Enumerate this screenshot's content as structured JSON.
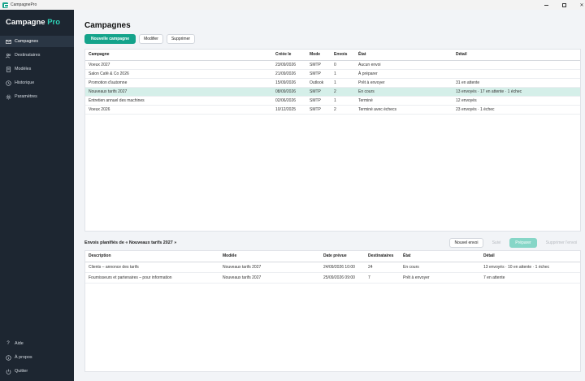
{
  "window": {
    "title": "CampagnePro"
  },
  "brand": {
    "name": "Campagne",
    "accent": "Pro"
  },
  "sidebar": {
    "items": [
      {
        "label": "Campagnes",
        "icon": "mail-icon",
        "active": true
      },
      {
        "label": "Destinataires",
        "icon": "users-icon"
      },
      {
        "label": "Modèles",
        "icon": "document-icon"
      },
      {
        "label": "Historique",
        "icon": "clock-icon"
      },
      {
        "label": "Paramètres",
        "icon": "gear-icon"
      }
    ],
    "bottom": [
      {
        "label": "Aide",
        "icon": "help-icon"
      },
      {
        "label": "À propos",
        "icon": "info-icon"
      },
      {
        "label": "Quitter",
        "icon": "power-icon"
      }
    ]
  },
  "page": {
    "title": "Campagnes"
  },
  "toolbar": {
    "new_campaign": "Nouvelle campagne",
    "edit": "Modifier",
    "delete": "Supprimer"
  },
  "campaigns": {
    "headers": [
      "Campagne",
      "Créée le",
      "Mode",
      "Envois",
      "État",
      "Détail"
    ],
    "rows": [
      [
        "Voeux 2027",
        "23/09/2026",
        "SMTP",
        "0",
        "Aucun envoi",
        ""
      ],
      [
        "Salon Café & Co 2026",
        "21/09/2026",
        "SMTP",
        "1",
        "À préparer",
        ""
      ],
      [
        "Promotion d'automne",
        "15/09/2026",
        "Outlook",
        "1",
        "Prêt à envoyer",
        "31 en attente"
      ],
      [
        "Nouveaux tarifs 2027",
        "08/09/2026",
        "SMTP",
        "2",
        "En cours",
        "13 envoyés · 17 en attente · 1 échec"
      ],
      [
        "Entretien annuel des machines",
        "02/06/2026",
        "SMTP",
        "1",
        "Terminé",
        "12 envoyés"
      ],
      [
        "Voeux 2026",
        "10/12/2025",
        "SMTP",
        "2",
        "Terminé avec échecs",
        "23 envoyés · 1 échec"
      ]
    ],
    "selected_index": 3
  },
  "sends": {
    "title": "Envois planifiés de « Nouveaux tarifs 2027 »",
    "toolbar": {
      "new_send": "Nouvel envoi",
      "follow": "Suivi",
      "prepare": "Préparer",
      "delete": "Supprimer l'envoi"
    },
    "headers": [
      "Description",
      "Modèle",
      "Date prévue",
      "Destinataires",
      "État",
      "Détail"
    ],
    "rows": [
      [
        "Clients – annonce des tarifs",
        "Nouveaux tarifs 2027",
        "24/09/2026 10:00",
        "24",
        "En cours",
        "13 envoyés · 10 en attente · 1 échec"
      ],
      [
        "Fournisseurs et partenaires – pour information",
        "Nouveaux tarifs 2027",
        "25/09/2026 09:00",
        "7",
        "Prêt à envoyer",
        "7 en attente"
      ]
    ]
  },
  "colors": {
    "accent": "#14a38b",
    "sidebar_bg": "#1d2631",
    "selected_row": "#d5efe9"
  }
}
